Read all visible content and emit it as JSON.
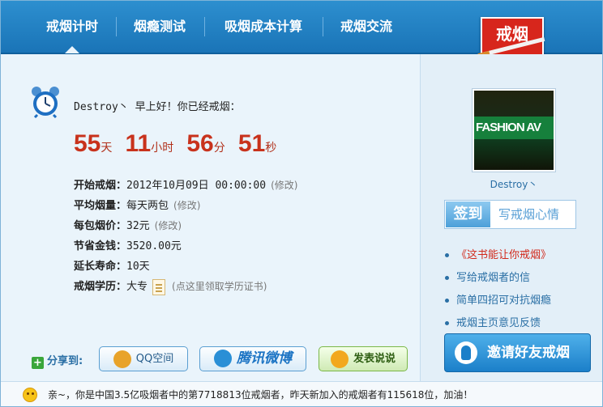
{
  "nav": {
    "tabs": [
      {
        "label": "戒烟计时"
      },
      {
        "label": "烟瘾测试"
      },
      {
        "label": "吸烟成本计算"
      },
      {
        "label": "戒烟交流"
      }
    ],
    "logo_line1": "戒烟",
    "logo_line2": "主页"
  },
  "main": {
    "greeting": "Destroy丶  早上好！你已经戒烟：",
    "counter": {
      "days": "55",
      "days_unit": "天",
      "hours": "11",
      "hours_unit": "小时",
      "minutes": "56",
      "minutes_unit": "分",
      "seconds": "51",
      "seconds_unit": "秒"
    },
    "rows": [
      {
        "label": "开始戒烟：",
        "value": "2012年10月09日 00:00:00",
        "edit": "(修改)"
      },
      {
        "label": "平均烟量：",
        "value": "每天两包",
        "edit": "(修改)"
      },
      {
        "label": "每包烟价：",
        "value": "32元",
        "edit": "(修改)"
      },
      {
        "label": "节省金钱：",
        "value": "3520.00元"
      },
      {
        "label": "延长寿命：",
        "value": "10天"
      },
      {
        "label": "戒烟学历：",
        "value": "大专",
        "hint": "(点这里领取学历证书)"
      }
    ]
  },
  "share": {
    "label": "分享到:",
    "buttons": [
      {
        "label": "QQ空间",
        "icon": "qzone-star-icon",
        "color": "#e8a32a"
      },
      {
        "label": "腾讯微博",
        "icon": "tencent-weibo-icon",
        "color": "#2a8fd6"
      },
      {
        "label": "发表说说",
        "icon": "shuoshuo-star-icon",
        "color": "#f2a81d"
      }
    ]
  },
  "sidebar": {
    "avatar_text": "FASHION AV",
    "username": "Destroy丶",
    "checkin_label": "签到",
    "mood_label": "写戒烟心情",
    "links": [
      {
        "label": "《这书能让你戒烟》",
        "highlight": true
      },
      {
        "label": "写给戒烟者的信"
      },
      {
        "label": "简单四招可对抗烟瘾"
      },
      {
        "label": "戒烟主页意见反馈"
      }
    ],
    "invite_label": "邀请好友戒烟"
  },
  "footer": {
    "notice": "亲~，你是中国3.5亿吸烟者中的第7718813位戒烟者，昨天新加入的戒烟者有115618位，加油！"
  }
}
